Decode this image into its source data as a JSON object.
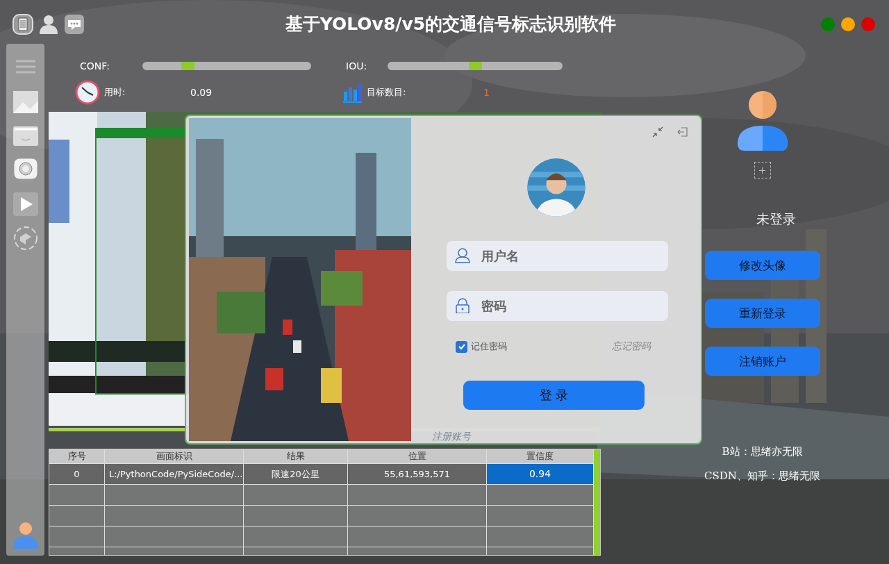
{
  "window": {
    "title": "基于YOLOv8/v5的交通信号标志识别软件"
  },
  "window_controls": [
    {
      "color": "#008000"
    },
    {
      "color": "#ffa500"
    },
    {
      "color": "#dd0000"
    }
  ],
  "sliders": [
    {
      "label": "CONF:",
      "level": 0.25
    },
    {
      "label": "IOU:",
      "level": 0.5
    }
  ],
  "stats": [
    {
      "kind": "time",
      "label": "用时:",
      "value": "0.09"
    },
    {
      "kind": "count",
      "label": "目标数目:",
      "value": "1"
    }
  ],
  "table": {
    "columns": [
      "序号",
      "画面标识",
      "结果",
      "位置",
      "置信度"
    ],
    "rows": [
      {
        "cells": [
          {
            "text": "0",
            "selected": false
          },
          {
            "text": "L:/PythonCode/PySideCode/...",
            "selected": false
          },
          {
            "text": "限速20公里",
            "selected": false
          },
          {
            "text": "55,61,593,571",
            "selected": false
          },
          {
            "text": "0.94",
            "selected": true
          }
        ]
      }
    ]
  },
  "login": {
    "username": {
      "placeholder": "用户名"
    },
    "password": {
      "placeholder": "密码"
    },
    "remember": {
      "label": "记住密码",
      "checked": true
    },
    "forgot_link": "忘记密码",
    "submit": "登 录",
    "register_link": "注册账号"
  },
  "profile": {
    "status": "未登录",
    "buttons": [
      "修改头像",
      "重新登录",
      "注销账户"
    ],
    "credits": [
      "B站：思绪亦无限",
      "CSDN、知乎：思绪无限"
    ]
  }
}
